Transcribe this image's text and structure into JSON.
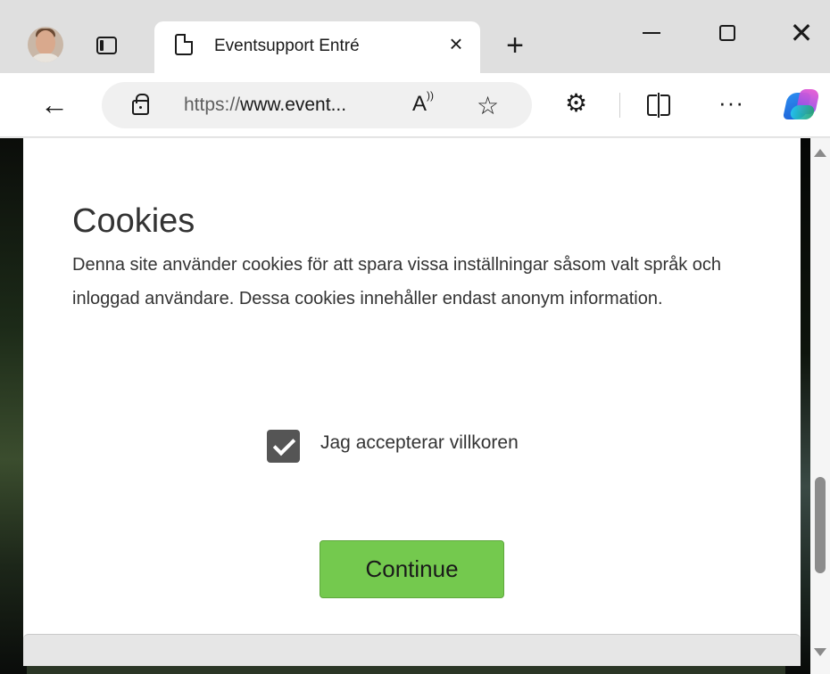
{
  "browser": {
    "tab": {
      "title": "Eventsupport Entré",
      "close_glyph": "×"
    },
    "new_tab_glyph": "+",
    "window_controls": {
      "minimize_icon": "minimize-icon",
      "maximize_icon": "maximize-icon",
      "close_glyph": "✕"
    },
    "toolbar": {
      "back_glyph": "←",
      "url_scheme": "https://",
      "url_rest": "www.event...",
      "read_aloud_glyph": "A",
      "read_aloud_wave": "))",
      "favorite_glyph": "☆",
      "extensions_glyph": "⚙",
      "more_glyph": "···"
    }
  },
  "cookie_dialog": {
    "title": "Cookies",
    "body": "Denna site använder cookies för att spara vissa inställningar såsom valt språk och inloggad användare. Dessa cookies innehåller endast anonym information.",
    "accept_checkbox": {
      "label": "Jag accepterar villkoren",
      "checked": true
    },
    "continue_label": "Continue",
    "continue_color": "#74c94e"
  }
}
